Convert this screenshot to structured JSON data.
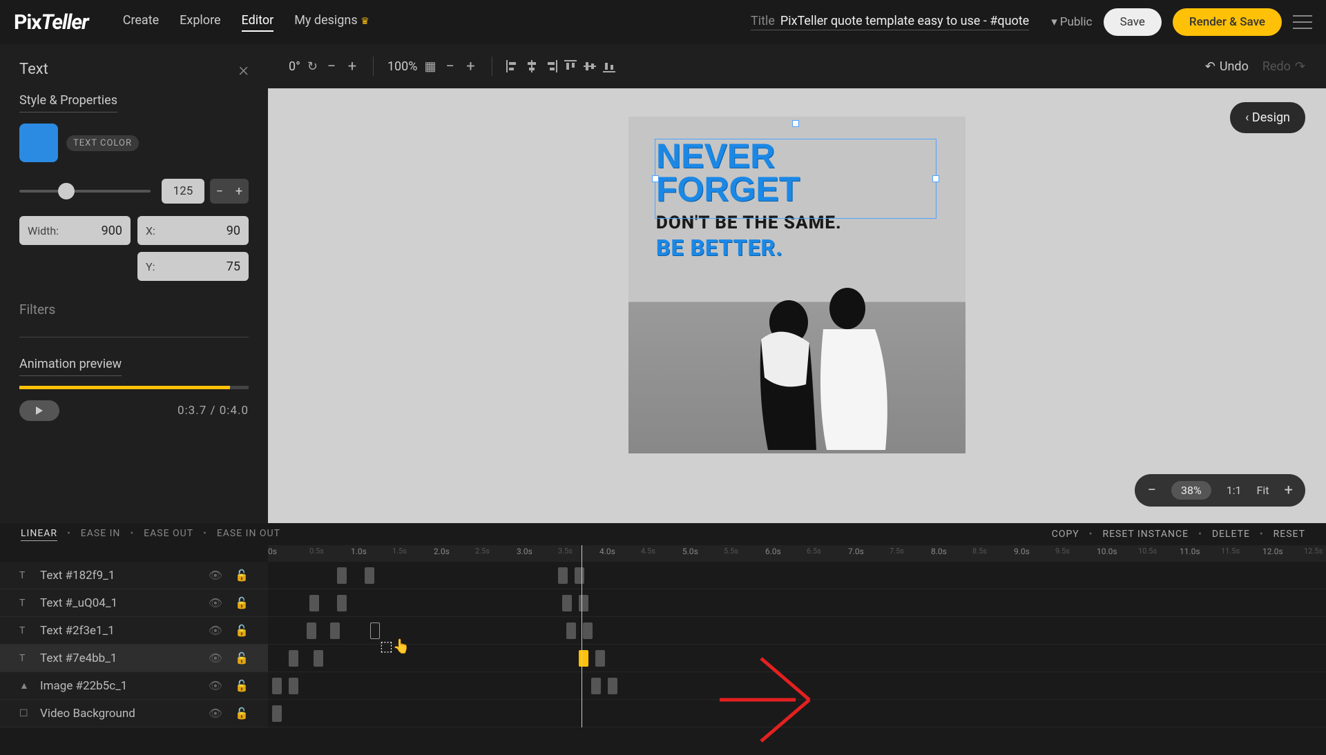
{
  "topbar": {
    "logo_1": "Pix",
    "logo_2": "Teller",
    "nav": {
      "create": "Create",
      "explore": "Explore",
      "editor": "Editor",
      "my_designs": "My designs"
    },
    "title_label": "Title",
    "title_text": "PixTeller quote template easy to use - #quote",
    "visibility": "Public",
    "save": "Save",
    "render": "Render & Save"
  },
  "sidebar": {
    "title": "Text",
    "style_props": "Style & Properties",
    "text_color_label": "TEXT COLOR",
    "text_color": "#2b8ae2",
    "size_value": "125",
    "width_label": "Width:",
    "width_value": "900",
    "x_label": "X:",
    "x_value": "90",
    "y_label": "Y:",
    "y_value": "75",
    "filters": "Filters",
    "anim_preview": "Animation preview",
    "time_current": "0:3.7",
    "time_sep": "/",
    "time_total": "0:4.0"
  },
  "toolbar": {
    "rotation": "0°",
    "zoom": "100%",
    "undo": "Undo",
    "redo": "Redo"
  },
  "canvas": {
    "design_btn": "‹ Design",
    "quote_line1": "NEVER",
    "quote_line2": "FORGET",
    "quote_line3": "DON'T BE THE SAME.",
    "quote_line4": "BE BETTER.",
    "zoom_pct": "38%",
    "zoom_11": "1:1",
    "zoom_fit": "Fit"
  },
  "timeline": {
    "ease": {
      "linear": "LINEAR",
      "in": "EASE IN",
      "out": "EASE OUT",
      "inout": "EASE IN OUT"
    },
    "actions": {
      "copy": "COPY",
      "reset_instance": "RESET INSTANCE",
      "delete": "DELETE",
      "reset": "RESET"
    },
    "ticks_major": [
      "0s",
      "1.0s",
      "2.0s",
      "3.0s",
      "4.0s",
      "5.0s",
      "6.0s",
      "7.0s",
      "8.0s",
      "9.0s",
      "10.0s",
      "11.0s",
      "12.0s"
    ],
    "ticks_minor": [
      "0.5s",
      "1.5s",
      "2.5s",
      "3.5s",
      "4.5s",
      "5.5s",
      "6.5s",
      "7.5s",
      "8.5s",
      "9.5s",
      "10.5s",
      "11.5s",
      "12.5s"
    ],
    "layers": [
      {
        "name": "Text #182f9_1",
        "type": "text"
      },
      {
        "name": "Text #_uQ04_1",
        "type": "text"
      },
      {
        "name": "Text #2f3e1_1",
        "type": "text"
      },
      {
        "name": "Text #7e4bb_1",
        "type": "text",
        "selected": true
      },
      {
        "name": "Image #22b5c_1",
        "type": "image"
      },
      {
        "name": "Video Background",
        "type": "video"
      }
    ]
  }
}
